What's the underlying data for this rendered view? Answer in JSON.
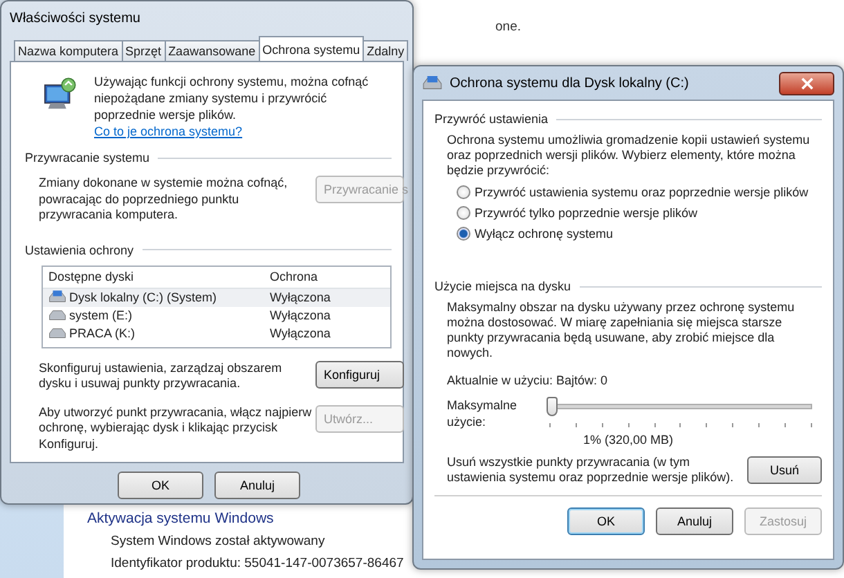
{
  "background": {
    "top_text": "one.",
    "heading": "Aktywacja systemu Windows",
    "lines": [
      "System Windows został aktywowany",
      "Identyfikator produktu: 55041-147-0073657-86467"
    ]
  },
  "system_properties": {
    "title": "Właściwości systemu",
    "tabs": [
      {
        "label": "Nazwa komputera",
        "selected": false
      },
      {
        "label": "Sprzęt",
        "selected": false
      },
      {
        "label": "Zaawansowane",
        "selected": false
      },
      {
        "label": "Ochrona systemu",
        "selected": true
      },
      {
        "label": "Zdalny",
        "selected": false
      }
    ],
    "intro": "Używając funkcji ochrony systemu, można cofnąć niepożądane zmiany systemu i przywrócić poprzednie wersje plików.",
    "intro_link": "Co to je ochrona systemu?",
    "restore_group": {
      "title": "Przywracanie systemu",
      "text": "Zmiany dokonane w systemie można cofnąć, powracając do poprzedniego punktu przywracania komputera.",
      "button": {
        "label": "Przywracanie s",
        "disabled": true
      }
    },
    "protection_group": {
      "title": "Ustawienia ochrony",
      "columns": [
        "Dostępne dyski",
        "Ochrona"
      ],
      "rows": [
        {
          "drive": "Dysk lokalny (C:) (System)",
          "protection": "Wyłączona",
          "kind": "system",
          "selected": true
        },
        {
          "drive": "system (E:)",
          "protection": "Wyłączona",
          "kind": "disk",
          "selected": false
        },
        {
          "drive": "PRACA (K:)",
          "protection": "Wyłączona",
          "kind": "disk",
          "selected": false
        }
      ],
      "configure_text": "Skonfiguruj ustawienia, zarządzaj obszarem dysku i usuwaj punkty przywracania.",
      "configure_button": {
        "label": "Konfiguruj",
        "disabled": false
      },
      "create_text": "Aby utworzyć punkt przywracania, włącz najpierw ochronę, wybierając dysk i klikając przycisk Konfiguruj.",
      "create_button": {
        "label": "Utwórz...",
        "disabled": true
      }
    },
    "buttons": [
      {
        "label": "OK",
        "disabled": false
      },
      {
        "label": "Anuluj",
        "disabled": false
      }
    ]
  },
  "protection_dialog": {
    "title": "Ochrona systemu dla Dysk lokalny (C:)",
    "restore_settings": {
      "title": "Przywróć ustawienia",
      "text": "Ochrona systemu umożliwia gromadzenie kopii ustawień systemu oraz poprzednich wersji plików. Wybierz elementy, które można będzie przywrócić:",
      "options": [
        {
          "label": "Przywróć ustawienia systemu oraz poprzednie wersje plików",
          "selected": false
        },
        {
          "label": "Przywróć tylko poprzednie wersje plików",
          "selected": false
        },
        {
          "label": "Wyłącz ochronę systemu",
          "selected": true
        }
      ]
    },
    "disk_usage": {
      "title": "Użycie miejsca na dysku",
      "text": "Maksymalny obszar na dysku używany przez ochronę systemu można dostosować. W miarę zapełniania się miejsca starsze punkty przywracania będą usuwane, aby zrobić miejsce dla nowych.",
      "current": "Aktualnie w użyciu: Bajtów: 0",
      "slider_label": "Maksymalne użycie:",
      "level": 0.01,
      "reading": "1% (320,00 MB)",
      "delete_text": "Usuń wszystkie punkty przywracania (w tym ustawienia systemu oraz poprzednie wersje plików).",
      "delete_button": {
        "label": "Usuń",
        "disabled": false
      }
    },
    "buttons": [
      {
        "label": "OK",
        "disabled": false,
        "focused": true
      },
      {
        "label": "Anuluj",
        "disabled": false,
        "focused": false
      },
      {
        "label": "Zastosuj",
        "disabled": true,
        "focused": false
      }
    ]
  }
}
